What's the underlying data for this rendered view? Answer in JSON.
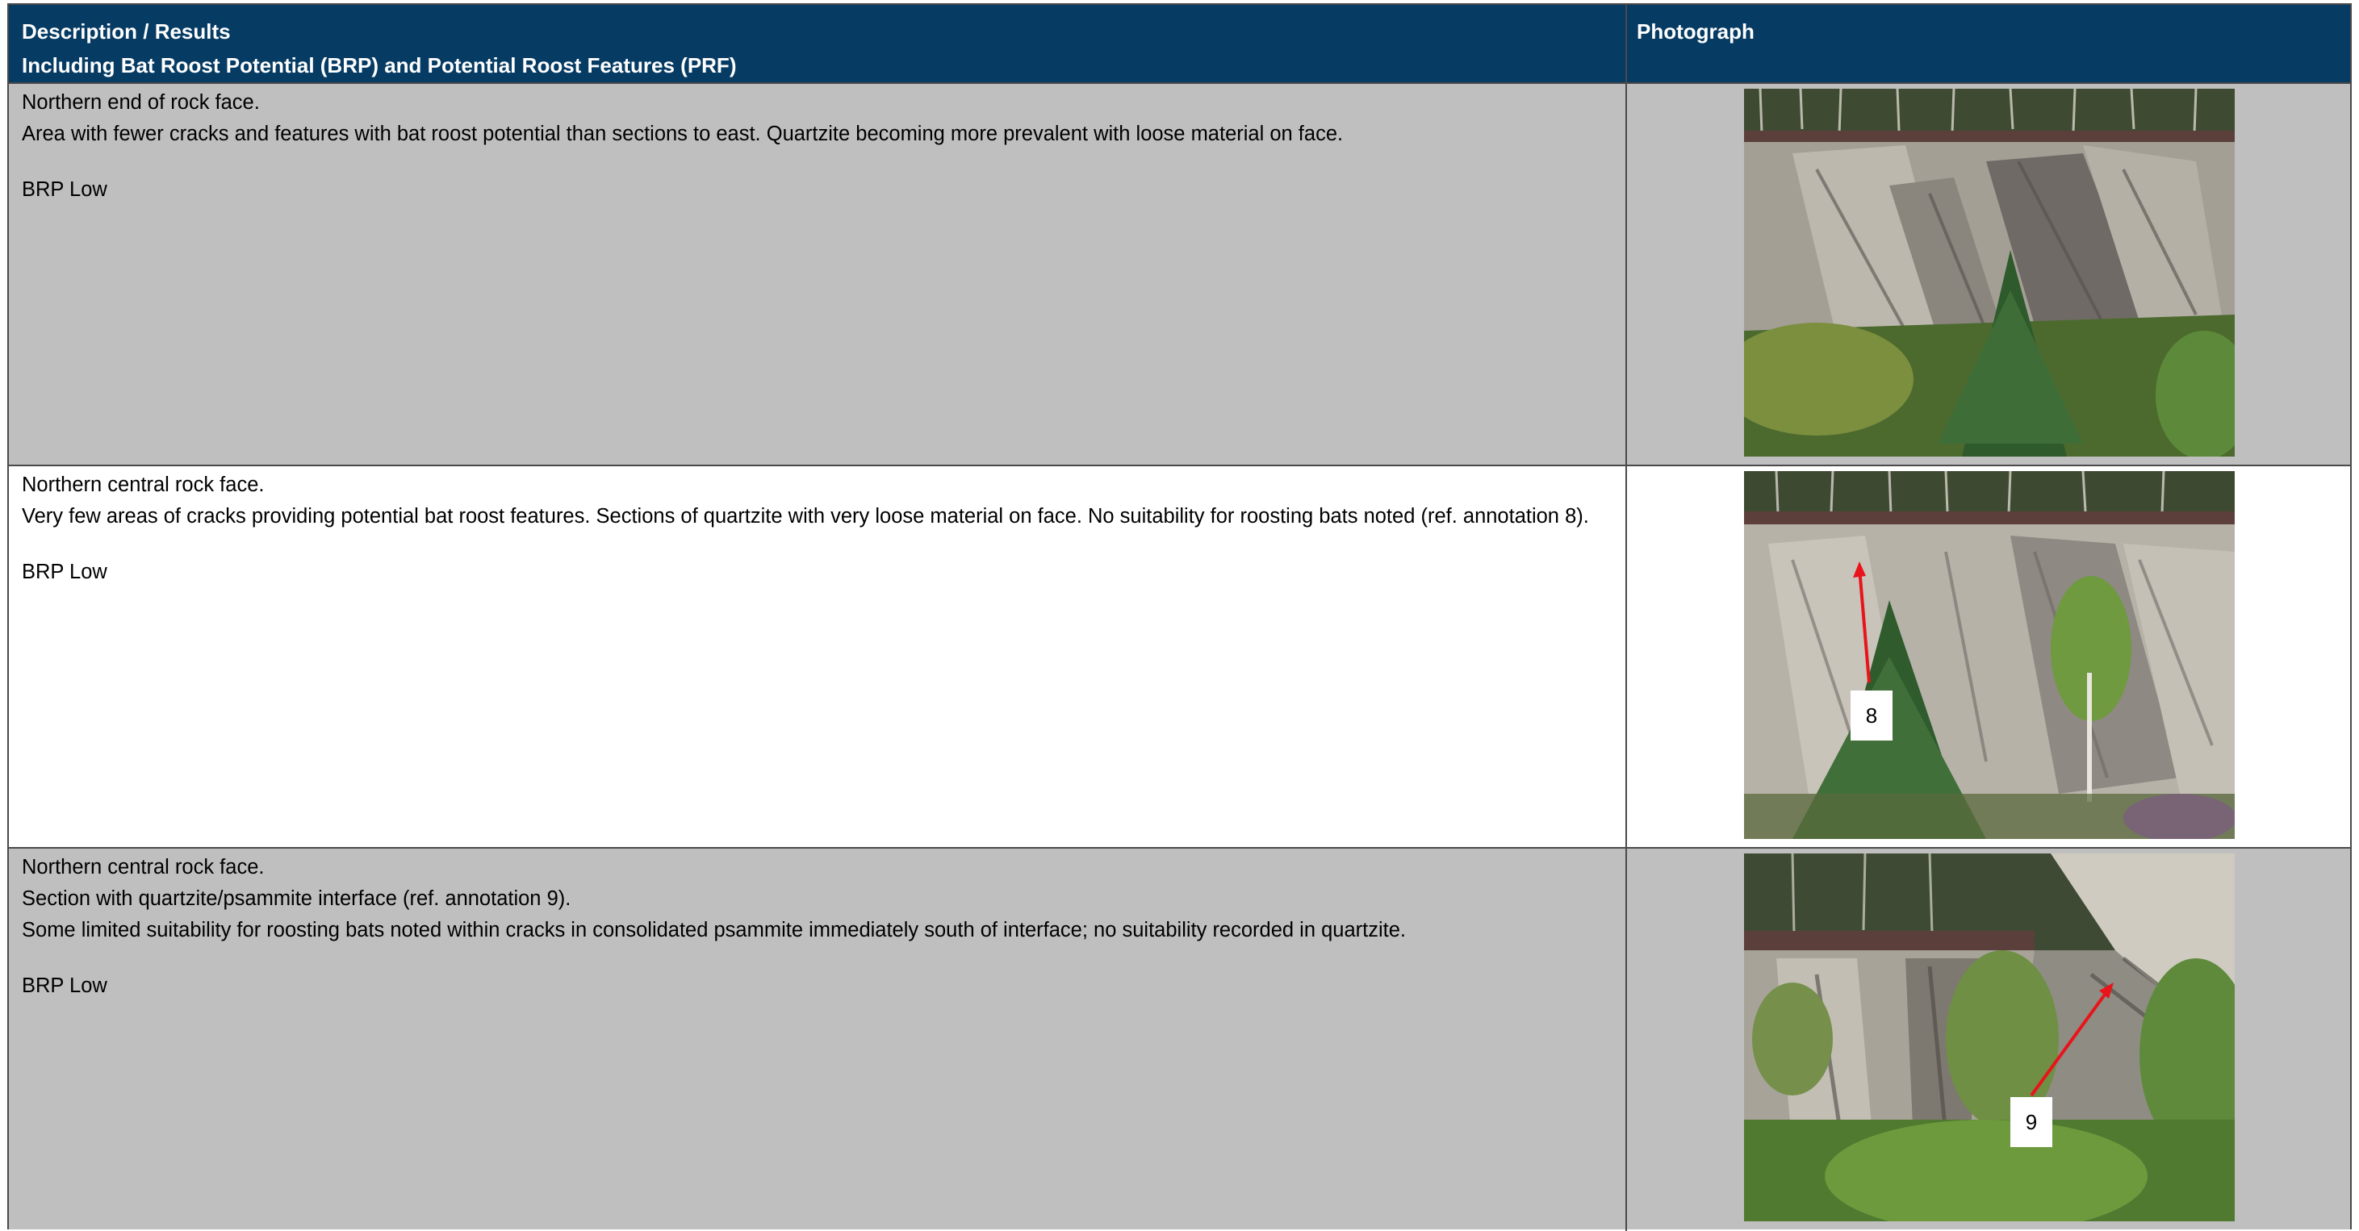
{
  "header": {
    "col1_line1": "Description / Results",
    "col1_line2": "Including Bat Roost Potential (BRP) and Potential Roost Features (PRF)",
    "col2": "Photograph",
    "background": "#063b63"
  },
  "rows": [
    {
      "lines": [
        "Northern end of rock face.",
        "Area with fewer cracks and features with bat roost potential than sections to east.  Quartzite becoming more prevalent with loose material on face."
      ],
      "brp": "BRP Low",
      "background": "#bfbfbf"
    },
    {
      "lines": [
        "Northern central rock face.",
        "Very few areas of cracks providing potential bat roost features.  Sections of quartzite with very loose material on face. No suitability for roosting bats noted (ref. annotation 8)."
      ],
      "brp": "BRP Low",
      "annotation": "8",
      "background": "#ffffff"
    },
    {
      "lines": [
        "Northern central rock face.",
        "Section with quartzite/psammite interface (ref. annotation 9).",
        "Some limited suitability for roosting bats noted within cracks in consolidated psammite immediately south of interface; no suitability recorded in quartzite."
      ],
      "brp": "BRP Low",
      "annotation": "9",
      "background": "#bfbfbf"
    }
  ],
  "annotation_arrow_color": "#e8141a"
}
